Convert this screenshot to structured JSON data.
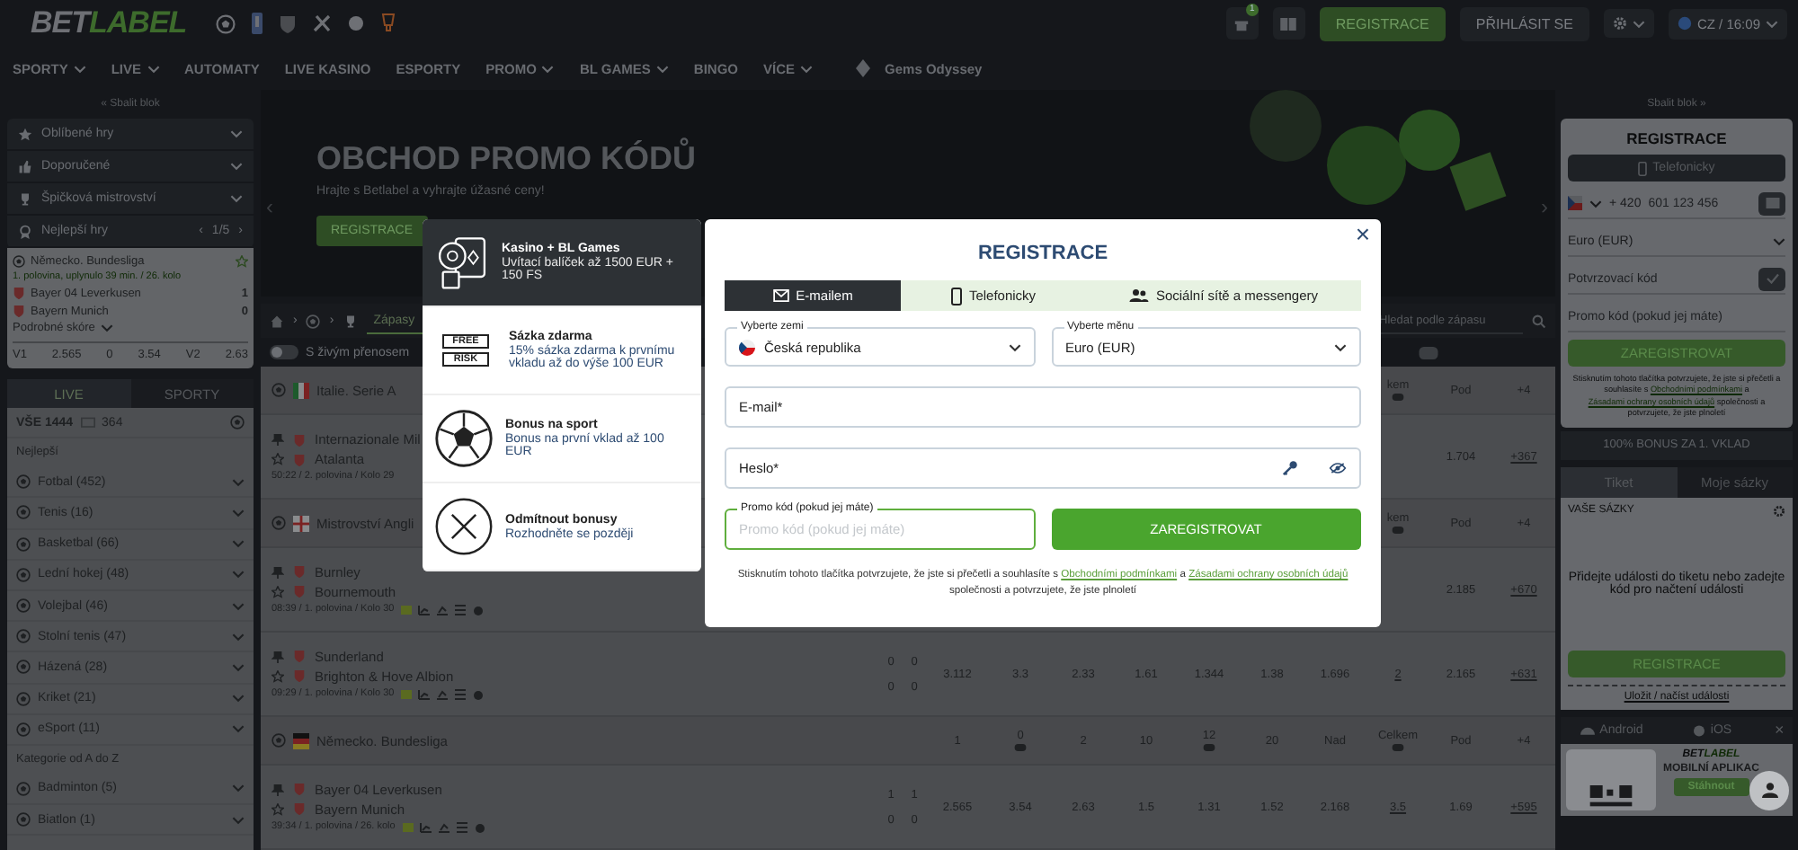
{
  "header": {
    "logo_left": "BET",
    "logo_right": "LABEL",
    "gift_badge": "1",
    "register": "REGISTRACE",
    "login": "PŘIHLÁSIT SE",
    "locale": "CZ / 16:09"
  },
  "nav": [
    {
      "label": "SPORTY",
      "dropdown": true
    },
    {
      "label": "LIVE",
      "dropdown": true
    },
    {
      "label": "AUTOMATY",
      "dropdown": false
    },
    {
      "label": "LIVE KASINO",
      "dropdown": false
    },
    {
      "label": "ESPORTY",
      "dropdown": false
    },
    {
      "label": "PROMO",
      "dropdown": true
    },
    {
      "label": "BL GAMES",
      "dropdown": true
    },
    {
      "label": "BINGO",
      "dropdown": false
    },
    {
      "label": "VÍCE",
      "dropdown": true
    }
  ],
  "nav_featured": "Gems Odyssey",
  "left": {
    "collapse": "« Sbalit blok",
    "menu": [
      {
        "label": "Oblíbené hry"
      },
      {
        "label": "Doporučené"
      },
      {
        "label": "Špičková mistrovství"
      }
    ],
    "top_games": {
      "label": "Nejlepší hry",
      "prev": "‹",
      "pager": "1/5",
      "next": "›"
    },
    "match": {
      "league": "Německo. Bundesliga",
      "status": "1. polovina, uplynulo 39 min. / 26. kolo",
      "teams": [
        {
          "name": "Bayer 04 Leverkusen",
          "score": "1"
        },
        {
          "name": "Bayern Munich",
          "score": "0"
        }
      ],
      "details": "Podrobné skóre",
      "odds": [
        "V1",
        "2.565",
        "0",
        "3.54",
        "V2",
        "2.63"
      ]
    },
    "tabs": [
      {
        "label": "LIVE",
        "selected": true
      },
      {
        "label": "SPORTY",
        "selected": false
      }
    ],
    "all_label": "VŠE 1444",
    "stream_count": "364",
    "best_heading": "Nejlepší",
    "sports": [
      {
        "label": "Fotbal (452)"
      },
      {
        "label": "Tenis (16)"
      },
      {
        "label": "Basketbal (66)"
      },
      {
        "label": "Lední hokej (48)"
      },
      {
        "label": "Volejbal (46)"
      },
      {
        "label": "Stolní tenis (47)"
      },
      {
        "label": "Házená (28)"
      },
      {
        "label": "Kriket (21)"
      },
      {
        "label": "eSport (11)"
      }
    ],
    "az_heading": "Kategorie od A do Z",
    "az_sports": [
      {
        "label": "Badminton (5)"
      },
      {
        "label": "Biatlon (1)"
      }
    ]
  },
  "banner": {
    "prev": "‹",
    "next": "›",
    "title": "OBCHOD PROMO KÓDŮ",
    "subtitle": "Hrajte s Betlabel a vyhrajte úžasné ceny!",
    "button": "REGISTRACE"
  },
  "filters": {
    "separators": [
      "›",
      "›"
    ],
    "tab": "Zápasy",
    "search_placeholder": "Hledat podle zápasu",
    "live_toggle": {
      "label": "S živým přenosem",
      "on": false
    }
  },
  "table": [
    {
      "kind": "league",
      "name": "Italie. Serie A",
      "cols": [
        "kem",
        "Pod",
        "+4"
      ]
    },
    {
      "kind": "match",
      "teams": [
        "Internazionale Mil",
        "Atalanta"
      ],
      "info": "50:22 / 2. polovina / Kolo 29",
      "info_icons": false,
      "cols": [
        "1.704",
        "+367"
      ]
    },
    {
      "kind": "league",
      "name": "Mistrovství Angli",
      "cols": [
        "kem",
        "Pod",
        "+4"
      ]
    },
    {
      "kind": "match",
      "teams": [
        "Burnley",
        "Bournemouth"
      ],
      "info": "08:39 / 1. polovina / Kolo 30",
      "info_icons": true,
      "cols": [
        "2.185",
        "+670"
      ]
    },
    {
      "kind": "match",
      "teams": [
        "Sunderland",
        "Brighton & Hove Albion"
      ],
      "scores": [
        [
          "0",
          "0"
        ],
        [
          "0",
          "0"
        ]
      ],
      "info": "09:29 / 1. polovina / Kolo 30",
      "info_icons": true,
      "cols": [
        "3.112",
        "3.3",
        "2.33",
        "1.61",
        "1.344",
        "1.38",
        "1.696",
        "2",
        "2.165",
        "+631"
      ]
    },
    {
      "kind": "league",
      "name": "Německo. Bundesliga",
      "cols": [
        "1",
        "0",
        "2",
        "10",
        "12",
        "20",
        "Nad",
        "Celkem",
        "Pod",
        "+4"
      ]
    },
    {
      "kind": "match",
      "teams": [
        "Bayer 04 Leverkusen",
        "Bayern Munich"
      ],
      "scores": [
        [
          "1",
          "1"
        ],
        [
          "0",
          "0"
        ]
      ],
      "info": "39:34 / 1. polovina / 26. kolo",
      "info_icons": true,
      "cols": [
        "2.565",
        "3.54",
        "2.63",
        "1.5",
        "1.31",
        "1.52",
        "2.168",
        "3.5",
        "1.69",
        "+595"
      ]
    }
  ],
  "promo_options": [
    {
      "kind": "casino",
      "title": "Kasino + BL Games",
      "text": "Uvítací balíček až 1500 EUR + 150 FS",
      "selected": true
    },
    {
      "kind": "freebet",
      "title": "Sázka zdarma",
      "text": "15% sázka zdarma k prvnímu vkladu až do výše 100 EUR",
      "selected": false,
      "ribbon_top": "FREE",
      "ribbon_bottom": "RISK"
    },
    {
      "kind": "sport",
      "title": "Bonus na sport",
      "text": "Bonus na první vklad až 100 EUR",
      "selected": false
    },
    {
      "kind": "decline",
      "title": "Odmítnout bonusy",
      "text": "Rozhodněte se později",
      "selected": false
    }
  ],
  "modal": {
    "title": "REGISTRACE",
    "close": "×",
    "tabs": [
      {
        "label": "E-mailem",
        "selected": true
      },
      {
        "label": "Telefonicky",
        "selected": false
      },
      {
        "label": "Sociální sítě a messengery",
        "selected": false
      }
    ],
    "country": {
      "label": "Vyberte zemi",
      "value": "Česká republika"
    },
    "currency": {
      "label": "Vyberte měnu",
      "value": "Euro (EUR)"
    },
    "email": {
      "placeholder": "E-mail*"
    },
    "password": {
      "placeholder": "Heslo*"
    },
    "promo": {
      "label": "Promo kód (pokud jej máte)",
      "placeholder": "Promo kód (pokud jej máte)",
      "focused": true
    },
    "submit": "ZAREGISTROVAT",
    "terms": {
      "before": "Stisknutím tohoto tlačítka potvrzujete, že jste si přečetli a souhlasíte s",
      "link1": "Obchodními podmínkami",
      "middle": "a",
      "link2": "Zásadami ochrany osobních údajů",
      "after": "společnosti a potvrzujete, že jste plnoletí"
    }
  },
  "right": {
    "collapse": "Sbalit blok »",
    "register": {
      "title": "REGISTRACE",
      "phone_tab": "Telefonicky",
      "prefix": "+ 420",
      "phone_placeholder": "601 123 456",
      "currency": "Euro (EUR)",
      "code_placeholder": "Potvrzovací kód",
      "promo_placeholder": "Promo kód (pokud jej máte)",
      "submit": "ZAREGISTROVAT",
      "terms": {
        "before": "Stisknutím tohoto tlačítka potvrzujete, že jste si přečetli a souhlasíte s",
        "link1": "Obchodními podmínkami",
        "middle": "a",
        "link2": "Zásadami ochrany osobních údajů",
        "after": "společnosti a potvrzujete, že jste plnoletí"
      }
    },
    "bonus": "100% BONUS ZA 1. VKLAD",
    "tabs": [
      {
        "label": "Tiket",
        "selected": true
      },
      {
        "label": "Moje sázky",
        "selected": false
      }
    ],
    "bets_title": "VAŠE SÁZKY",
    "empty": "Přidejte události do tiketu nebo zadejte kód pro načtení události",
    "register_button": "REGISTRACE",
    "save_load": "Uložit / načíst události",
    "app_tabs": [
      {
        "label": "Android"
      },
      {
        "label": "iOS"
      }
    ],
    "app_close": "×",
    "app_logo_left": "BET",
    "app_logo_right": "LABEL",
    "app_title": "MOBILNÍ APLIKAC",
    "app_button": "Stáhnout"
  }
}
